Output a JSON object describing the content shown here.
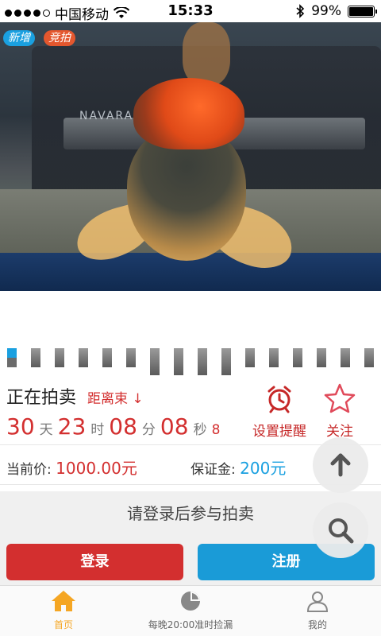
{
  "status_bar": {
    "carrier": "中国移动",
    "time": "15:33",
    "battery": "99%",
    "signal_bars": 4,
    "battery_level": 0.99
  },
  "photo": {
    "tags": {
      "new": "新增",
      "auction": "竞拍"
    },
    "thumbnail_count": 16,
    "active_index": 0,
    "truck_text": "NAVARA"
  },
  "auction": {
    "status": "正在拍卖",
    "countdown_label": "距离束 ↓",
    "days": "30",
    "days_unit": "天",
    "hours": "23",
    "hours_unit": "时",
    "minutes": "08",
    "minutes_unit": "分",
    "seconds": "08",
    "seconds_unit": "秒",
    "tenths": "8",
    "remind_label": "设置提醒",
    "follow_label": "关注"
  },
  "price": {
    "current_label": "当前价:",
    "current_value": "1000.00元",
    "deposit_label": "保证金:",
    "deposit_value": "200元"
  },
  "login": {
    "hint": "请登录后参与拍卖",
    "login_button": "登录",
    "register_button": "注册"
  },
  "tabs": [
    {
      "label": "首页",
      "icon": "home-icon"
    },
    {
      "label": "每晚20:00准时捡漏",
      "icon": "pie-chart-icon"
    },
    {
      "label": "我的",
      "icon": "user-icon"
    }
  ],
  "colors": {
    "accent_red": "#d32f2f",
    "accent_blue": "#1a9bd7",
    "home_active": "#f5a623"
  }
}
